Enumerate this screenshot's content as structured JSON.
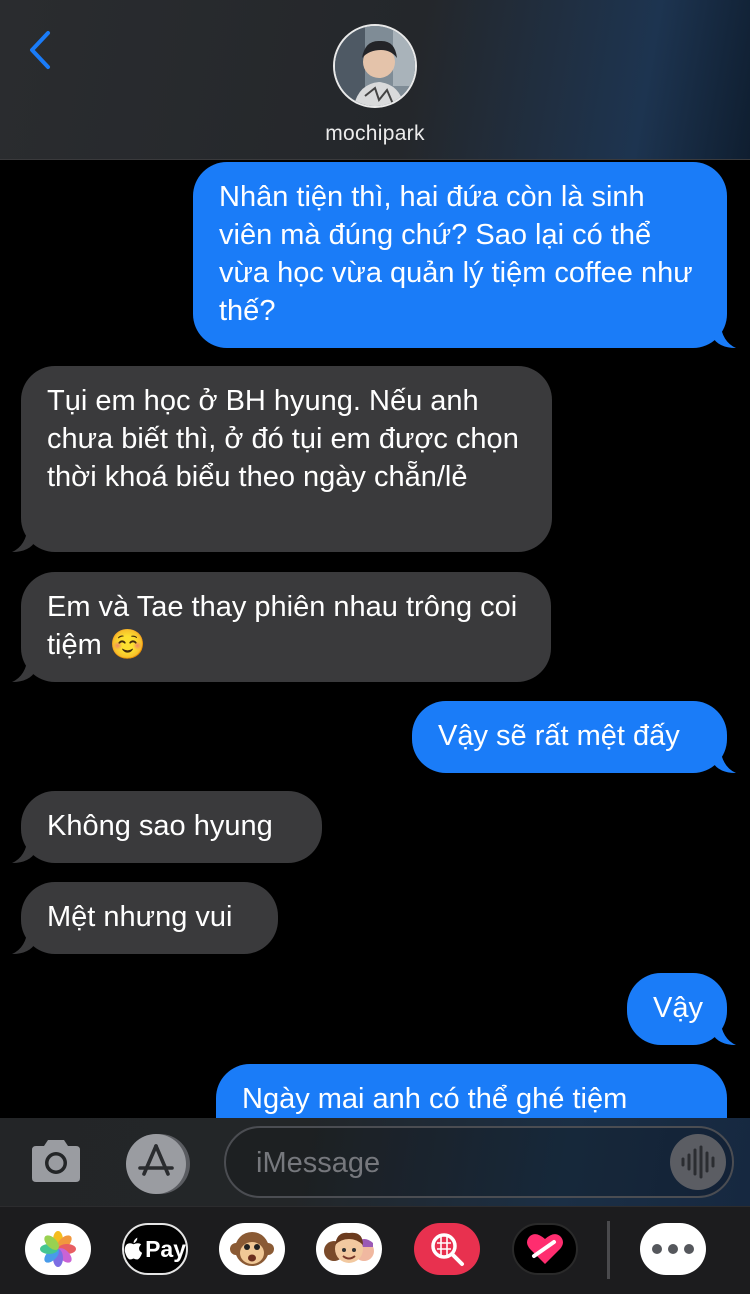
{
  "header": {
    "contact_name": "mochipark",
    "back_icon": "chevron-left-icon",
    "accent_color": "#1a7cf8"
  },
  "messages": [
    {
      "direction": "outgoing",
      "text": "Nhân tiện thì, hai đứa còn là sinh viên mà đúng chứ? Sao lại có thể vừa học vừa quản lý tiệm coffee như thế?"
    },
    {
      "direction": "incoming",
      "text": "Tụi em học ở BH hyung. Nếu anh chưa biết thì, ở đó tụi em được chọn thời khoá biểu theo ngày chẵn/lẻ"
    },
    {
      "direction": "incoming",
      "text": "Em và Tae thay phiên nhau trông coi tiệm ☺️"
    },
    {
      "direction": "outgoing",
      "text": "Vậy sẽ rất mệt đấy"
    },
    {
      "direction": "incoming",
      "text": "Không sao hyung"
    },
    {
      "direction": "incoming",
      "text": "Mệt nhưng vui"
    },
    {
      "direction": "outgoing",
      "text": "Vậy"
    },
    {
      "direction": "outgoing",
      "text": "Ngày mai anh có thể ghé tiệm"
    }
  ],
  "colors": {
    "outgoing_bubble": "#1a7cf8",
    "incoming_bubble": "#3a3a3c"
  },
  "compose": {
    "placeholder": "iMessage",
    "camera_icon": "camera-icon",
    "app_store_icon": "app-store-icon",
    "audio_icon": "audio-waveform-icon"
  },
  "tray": {
    "apple_pay_label": "Pay",
    "items": [
      "photos-icon",
      "apple-pay-icon",
      "animoji-monkey-icon",
      "memoji-icon",
      "image-search-icon",
      "digital-touch-icon",
      "more-icon"
    ]
  }
}
